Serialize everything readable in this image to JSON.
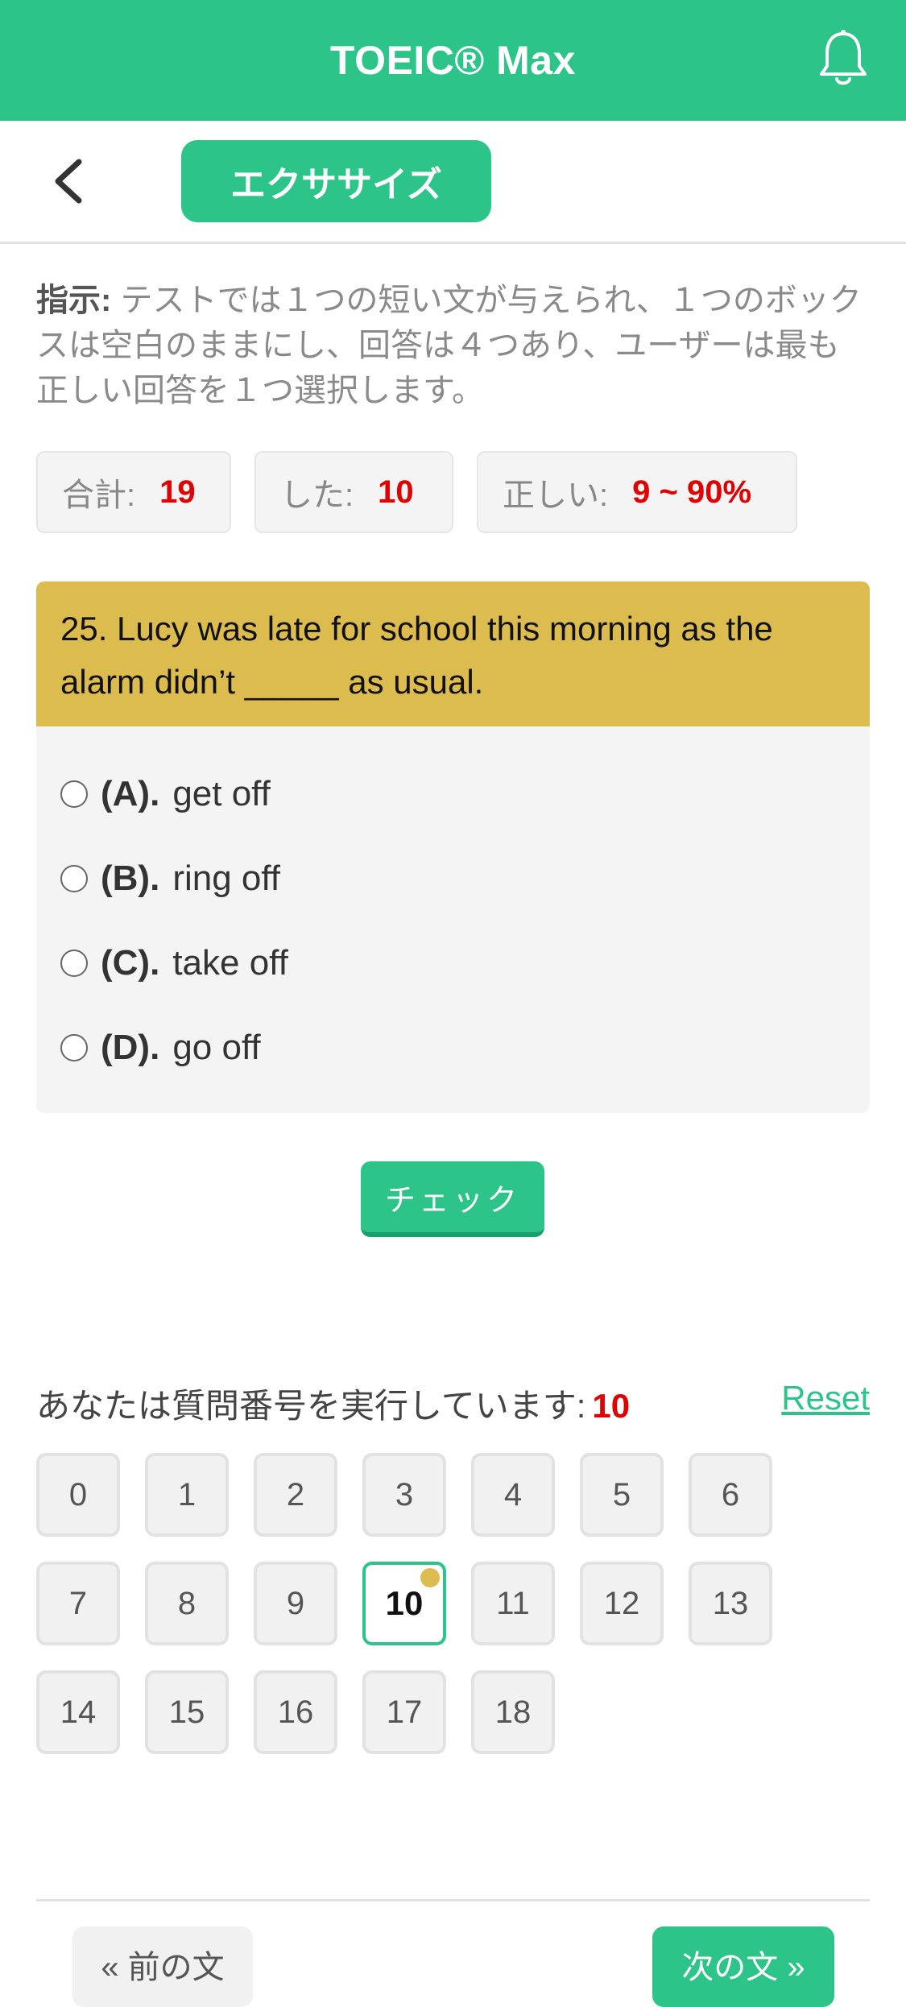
{
  "header": {
    "title": "TOEIC® Max",
    "icon": "bell-icon"
  },
  "subbar": {
    "back_icon": "chevron-left-icon",
    "tab_label": "エクササイズ"
  },
  "instruction": {
    "label": "指示:",
    "text": " テストでは１つの短い文が与えられ、１つのボックスは空白のままにし、回答は４つあり、ユーザーは最も正しい回答を１つ選択します。"
  },
  "stats": {
    "total_label": "合計:",
    "total_value": "19",
    "done_label": "した:",
    "done_value": "10",
    "correct_label": "正しい:",
    "correct_value": "9 ~ 90%"
  },
  "question": {
    "text": "25. Lucy was late for school this morning as the alarm didn’t _____ as usual.",
    "options": [
      {
        "label": "(A).",
        "text": "get off"
      },
      {
        "label": "(B).",
        "text": "ring off"
      },
      {
        "label": "(C).",
        "text": "take off"
      },
      {
        "label": "(D).",
        "text": "go off"
      }
    ]
  },
  "check_label": "チェック",
  "progress": {
    "running_label": "あなたは質問番号を実行しています:",
    "current": "10",
    "reset_label": "Reset",
    "numbers": [
      "0",
      "1",
      "2",
      "3",
      "4",
      "5",
      "6",
      "7",
      "8",
      "9",
      "10",
      "11",
      "12",
      "13",
      "14",
      "15",
      "16",
      "17",
      "18"
    ]
  },
  "footer": {
    "prev_label": "« 前の文",
    "next_label": "次の文 »"
  },
  "colors": {
    "primary": "#2dc48a",
    "question_bg": "#dcbc4e",
    "accent_red": "#e00000"
  }
}
